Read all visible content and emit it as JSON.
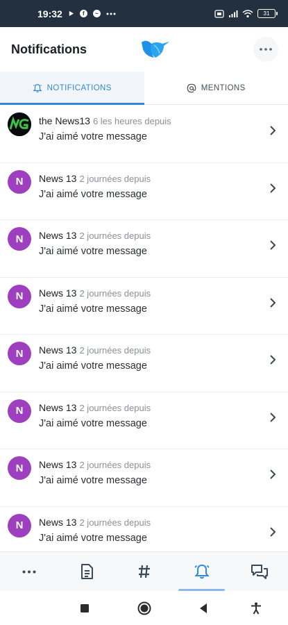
{
  "status_bar": {
    "time": "19:32",
    "left_icons": [
      "play-icon",
      "facebook-icon",
      "messenger-icon",
      "more-dots-icon"
    ],
    "right_icons": [
      "sim-icon",
      "signal-icon",
      "wifi-icon"
    ],
    "battery": "31"
  },
  "header": {
    "title": "Notifications",
    "logo": "bird-logo",
    "more_icon": "more-dots-icon"
  },
  "tabs": [
    {
      "label": "NOTIFICATIONS",
      "icon": "bell-icon",
      "active": true
    },
    {
      "label": "MENTIONS",
      "icon": "at-icon",
      "active": false
    }
  ],
  "notifications": [
    {
      "name": "the News13",
      "time": "6 les heures depuis",
      "message": "J'ai aimé votre message",
      "avatar_letter": "",
      "avatar_type": "logo"
    },
    {
      "name": "News 13",
      "time": "2 journées depuis",
      "message": "J'ai aimé votre message",
      "avatar_letter": "N",
      "avatar_type": "letter"
    },
    {
      "name": "News 13",
      "time": "2 journées depuis",
      "message": "J'ai aimé votre message",
      "avatar_letter": "N",
      "avatar_type": "letter"
    },
    {
      "name": "News 13",
      "time": "2 journées depuis",
      "message": "J'ai aimé votre message",
      "avatar_letter": "N",
      "avatar_type": "letter"
    },
    {
      "name": "News 13",
      "time": "2 journées depuis",
      "message": "J'ai aimé votre message",
      "avatar_letter": "N",
      "avatar_type": "letter"
    },
    {
      "name": "News 13",
      "time": "2 journées depuis",
      "message": "J'ai aimé votre message",
      "avatar_letter": "N",
      "avatar_type": "letter"
    },
    {
      "name": "News 13",
      "time": "2 journées depuis",
      "message": "J'ai aimé votre message",
      "avatar_letter": "N",
      "avatar_type": "letter"
    },
    {
      "name": "News 13",
      "time": "2 journées depuis",
      "message": "J'ai aimé votre message",
      "avatar_letter": "N",
      "avatar_type": "letter"
    }
  ],
  "bottom_nav": [
    {
      "icon": "more-dots-icon",
      "active": false
    },
    {
      "icon": "document-icon",
      "active": false
    },
    {
      "icon": "hashtag-icon",
      "active": false
    },
    {
      "icon": "bell-icon",
      "active": true
    },
    {
      "icon": "chat-icon",
      "active": false
    }
  ],
  "system_nav": [
    "square-icon",
    "circle-icon",
    "back-icon",
    "accessibility-icon"
  ],
  "colors": {
    "status_bar": "#233040",
    "accent": "#2f89d8",
    "avatar": "#9d3fbf",
    "active_tab_bg": "#f2f6fb"
  }
}
